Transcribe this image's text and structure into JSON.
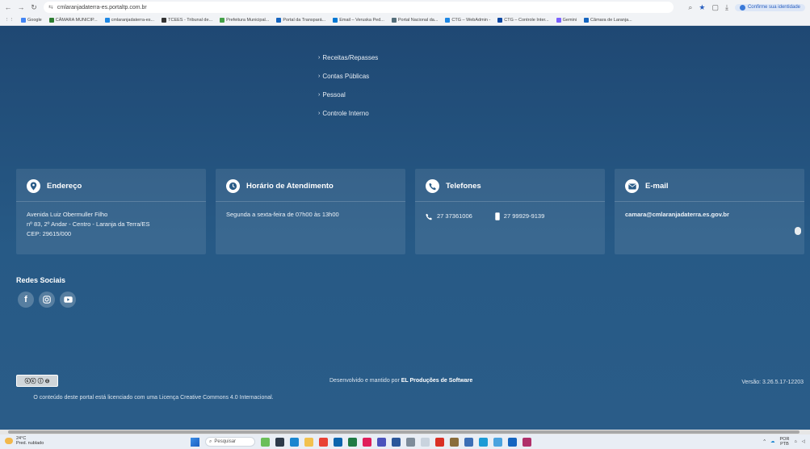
{
  "browser": {
    "url": "cmlaranjadaterra-es.portaltp.com.br",
    "identity_label": "Confirme sua identidade",
    "bookmarks": [
      {
        "label": "Google",
        "color": "#4285f4"
      },
      {
        "label": "CÂMARA MUNICIP...",
        "color": "#2e7d32"
      },
      {
        "label": "cmlaranjadaterra-es...",
        "color": "#1e88e5"
      },
      {
        "label": "TCEES - Tribunal de...",
        "color": "#333333"
      },
      {
        "label": "Prefeitura Municipal...",
        "color": "#43a047"
      },
      {
        "label": "Portal da Transpará...",
        "color": "#1565c0"
      },
      {
        "label": "Email – Veruska Ped...",
        "color": "#0078d4"
      },
      {
        "label": "Portal Nacional da...",
        "color": "#546e7a"
      },
      {
        "label": "CTG – WebAdmin -",
        "color": "#1e88e5"
      },
      {
        "label": "CTG – Controle Inter...",
        "color": "#0d47a1"
      },
      {
        "label": "Gemini",
        "color": "#7b61ff"
      },
      {
        "label": "Câmara de Laranja...",
        "color": "#1565c0"
      }
    ]
  },
  "menu": {
    "items": [
      "Receitas/Repasses",
      "Contas Públicas",
      "Pessoal",
      "Controle Interno"
    ]
  },
  "cards": {
    "address": {
      "title": "Endereço",
      "line1": "Avenida Luiz Obermuller Filho",
      "line2": "nº 83, 2º Andar - Centro - Laranja da Terra/ES",
      "line3": "CEP: 29615/000"
    },
    "hours": {
      "title": "Horário de Atendimento",
      "text": "Segunda a sexta-feira de 07h00 às 13h00"
    },
    "phones": {
      "title": "Telefones",
      "landline": "27 37361006",
      "mobile": "27 99929-9139"
    },
    "email": {
      "title": "E-mail",
      "address": "camara@cmlaranjadaterra.es.gov.br"
    }
  },
  "social": {
    "title": "Redes Sociais"
  },
  "footer": {
    "license_text": "O conteúdo deste portal está licenciado com uma Licença Creative Commons 4.0 Internacional.",
    "dev_prefix": "Desenvolvido e mantido por",
    "dev_company": "EL Produções de Software",
    "version": "Versão: 3.26.5.17-12203"
  },
  "taskbar": {
    "temperature": "24°C",
    "weather": "Pred. nublado",
    "search_placeholder": "Pesquisar",
    "lang": "POR",
    "lang2": "PTB"
  },
  "colors": {
    "background_top": "#1f4873",
    "background_bottom": "#2a5c88",
    "card_icon": "#2a5c88"
  }
}
